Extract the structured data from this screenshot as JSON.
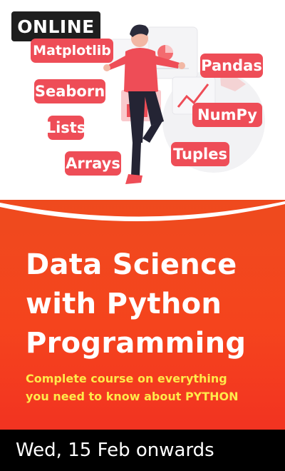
{
  "badge": {
    "label": "ONLINE"
  },
  "tags": {
    "matplotlib": "Matplotlib",
    "pandas": "Pandas",
    "seaborn": "Seaborn",
    "numpy": "NumPy",
    "lists": "Lists",
    "tuples": "Tuples",
    "arrays": "Arrays"
  },
  "title": {
    "line1": "Data Science",
    "line2": "with Python",
    "line3": "Programming"
  },
  "subtitle": {
    "line1": "Complete course on everything",
    "line2": "you need to know about PYTHON"
  },
  "footer": {
    "date_text": "Wed, 15 Feb onwards"
  },
  "colors": {
    "tag_red": "#ee4d57",
    "banner_orange": "#f5441d",
    "subtitle_yellow": "#ffe94a",
    "badge_dark": "#1e1e1e"
  }
}
